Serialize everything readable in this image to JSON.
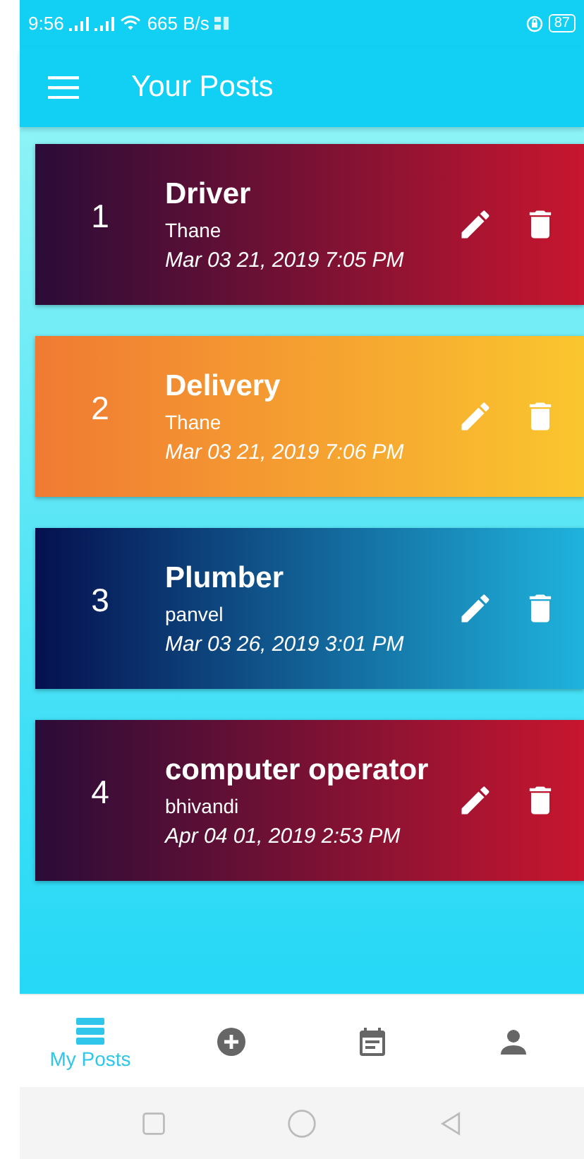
{
  "status_bar": {
    "time": "9:56",
    "speed": "665 B/s",
    "battery": "87"
  },
  "app_bar": {
    "title": "Your Posts"
  },
  "posts": [
    {
      "number": "1",
      "title": "Driver",
      "location": "Thane",
      "date": "Mar 03 21, 2019 7:05 PM",
      "kind": "crimson"
    },
    {
      "number": "2",
      "title": "Delivery",
      "location": "Thane",
      "date": "Mar 03 21, 2019 7:06 PM",
      "kind": "amber"
    },
    {
      "number": "3",
      "title": "Plumber",
      "location": "panvel",
      "date": "Mar 03 26, 2019 3:01 PM",
      "kind": "ocean"
    },
    {
      "number": "4",
      "title": "computer operator",
      "location": "bhivandi",
      "date": "Apr 04 01, 2019 2:53 PM",
      "kind": "crimson"
    }
  ],
  "bottom_nav": [
    {
      "kind": "list",
      "label": "My Posts",
      "selected": true
    },
    {
      "kind": "add",
      "selected": false
    },
    {
      "kind": "calendar",
      "selected": false
    },
    {
      "kind": "person",
      "selected": false
    }
  ]
}
